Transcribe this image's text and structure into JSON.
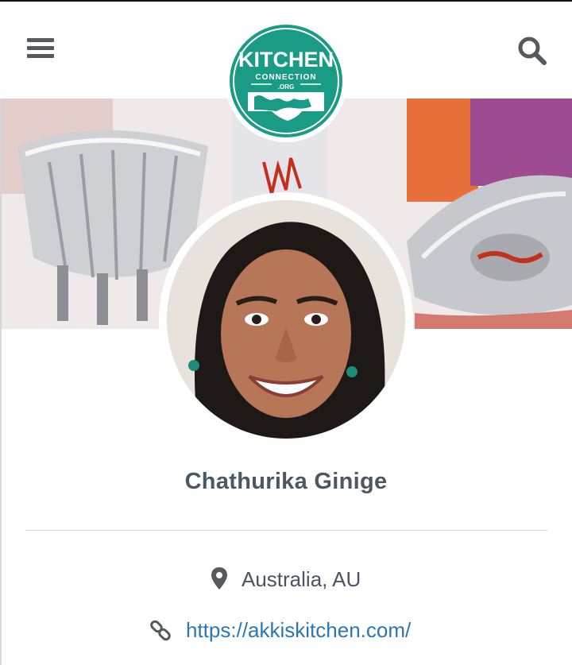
{
  "header": {
    "menu_icon": "hamburger-menu-icon",
    "search_icon": "search-icon",
    "logo": {
      "line1": "KITCHEN",
      "line2": "CONNECTION",
      "line3": ".ORG",
      "brand_color": "#1a9b85"
    }
  },
  "cover": {
    "description_icon": "cover-photo"
  },
  "profile": {
    "name": "Chathurika Ginige",
    "location": "Australia, AU",
    "location_icon": "map-pin-icon",
    "website": "https://akkiskitchen.com/",
    "website_icon": "link-icon"
  },
  "colors": {
    "name": "#4a5866",
    "link": "#2a77b8",
    "icon": "#555a5f"
  }
}
